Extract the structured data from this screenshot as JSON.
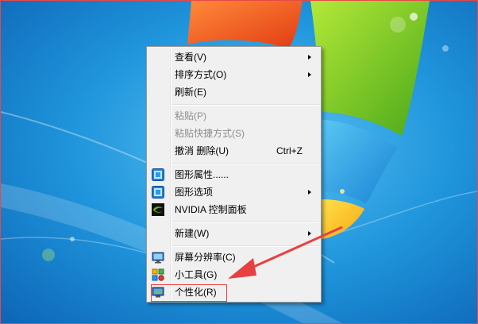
{
  "context_menu": {
    "items": [
      {
        "label": "查看(V)",
        "submenu": true
      },
      {
        "label": "排序方式(O)",
        "submenu": true
      },
      {
        "label": "刷新(E)"
      },
      {
        "label": "粘贴(P)",
        "disabled": true
      },
      {
        "label": "粘贴快捷方式(S)",
        "disabled": true
      },
      {
        "label": "撤消 删除(U)",
        "shortcut": "Ctrl+Z"
      },
      {
        "label": "图形属性......",
        "icon": "intel-graphics-icon"
      },
      {
        "label": "图形选项",
        "icon": "intel-graphics-icon",
        "submenu": true
      },
      {
        "label": "NVIDIA 控制面板",
        "icon": "nvidia-icon"
      },
      {
        "label": "新建(W)",
        "submenu": true
      },
      {
        "label": "屏幕分辨率(C)",
        "icon": "display-icon"
      },
      {
        "label": "小工具(G)",
        "icon": "gadgets-icon"
      },
      {
        "label": "个性化(R)",
        "icon": "personalize-icon"
      }
    ]
  },
  "colors": {
    "accent_annotation": "#e84040",
    "wallpaper_blue": "#1a86d2"
  }
}
